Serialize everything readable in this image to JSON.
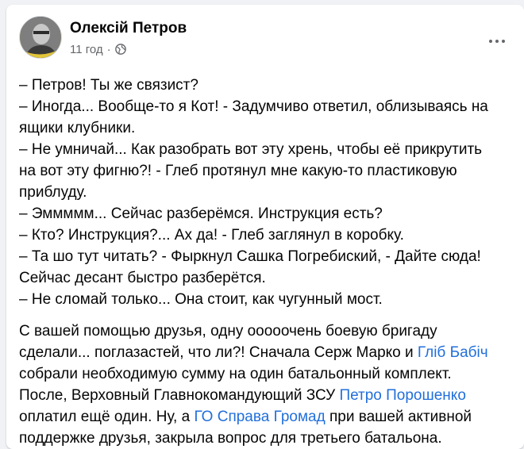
{
  "post": {
    "author": "Олексій Петров",
    "time": "11 год",
    "separator": "·",
    "icons": {
      "privacy": "globe-icon",
      "more": "more-dots-icon",
      "avatar": "profile-photo"
    },
    "dialog_lines": [
      "– Петров! Ты же связист?",
      "– Иногда... Вообще-то я Кот! - Задумчиво ответил, облизываясь на",
      "ящики клубники.",
      "– Не умничай... Как разобрать вот эту хрень, чтобы её прикрутить",
      "на вот эту фигню?! - Глеб протянул мне какую-то пластиковую",
      "приблуду.",
      "– Эммммм... Сейчас разберёмся. Инструкция есть?",
      "– Кто? Инструкция?... Ах да! - Глеб заглянул в коробку.",
      "– Та шо тут читать? - Фыркнул Сашка Погребиский, - Дайте сюда!",
      "Сейчас десант быстро разберётся.",
      "– Не сломай только... Она стоит, как чугунный мост."
    ],
    "paragraph": {
      "l1": "С вашей помощью друзья, одну ооооочень боевую бригаду",
      "l2a": "сделали... поглазастей, что ли?! Сначала Серж Марко и ",
      "link1": "Гліб Бабіч",
      "l3": "собрали необходимую сумму на один батальонный комплект.",
      "l4a": "После, Верховный Главнокомандующий ЗСУ ",
      "link2": "Петро Порошенко",
      "l5a": "оплатил ещё один. Ну, а ",
      "link3": "ГО Справа Громад",
      "l5b": " при вашей активной",
      "l6": "поддержке друзья, закрыла вопрос для третьего батальона."
    }
  },
  "colors": {
    "text": "#050505",
    "muted": "#65676b",
    "link": "#216fdb",
    "background": "#f0f2f5"
  }
}
